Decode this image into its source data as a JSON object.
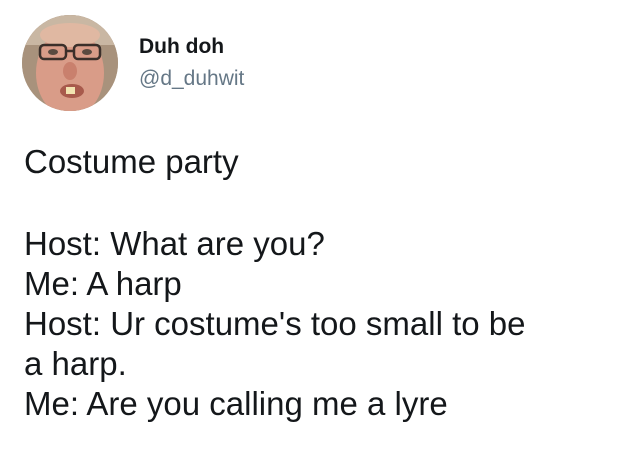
{
  "author": {
    "display_name": "Duh doh",
    "handle": "@d_duhwit",
    "avatar_icon": "user-avatar-photo"
  },
  "tweet": {
    "title_line": "Costume party",
    "dialogue": [
      "Host: What are you?",
      "Me: A harp",
      "Host: Ur costume's too small to be",
      "a harp.",
      "Me: Are you calling me a lyre"
    ]
  },
  "colors": {
    "text": "#14171a",
    "handle": "#657786",
    "background": "#ffffff"
  }
}
